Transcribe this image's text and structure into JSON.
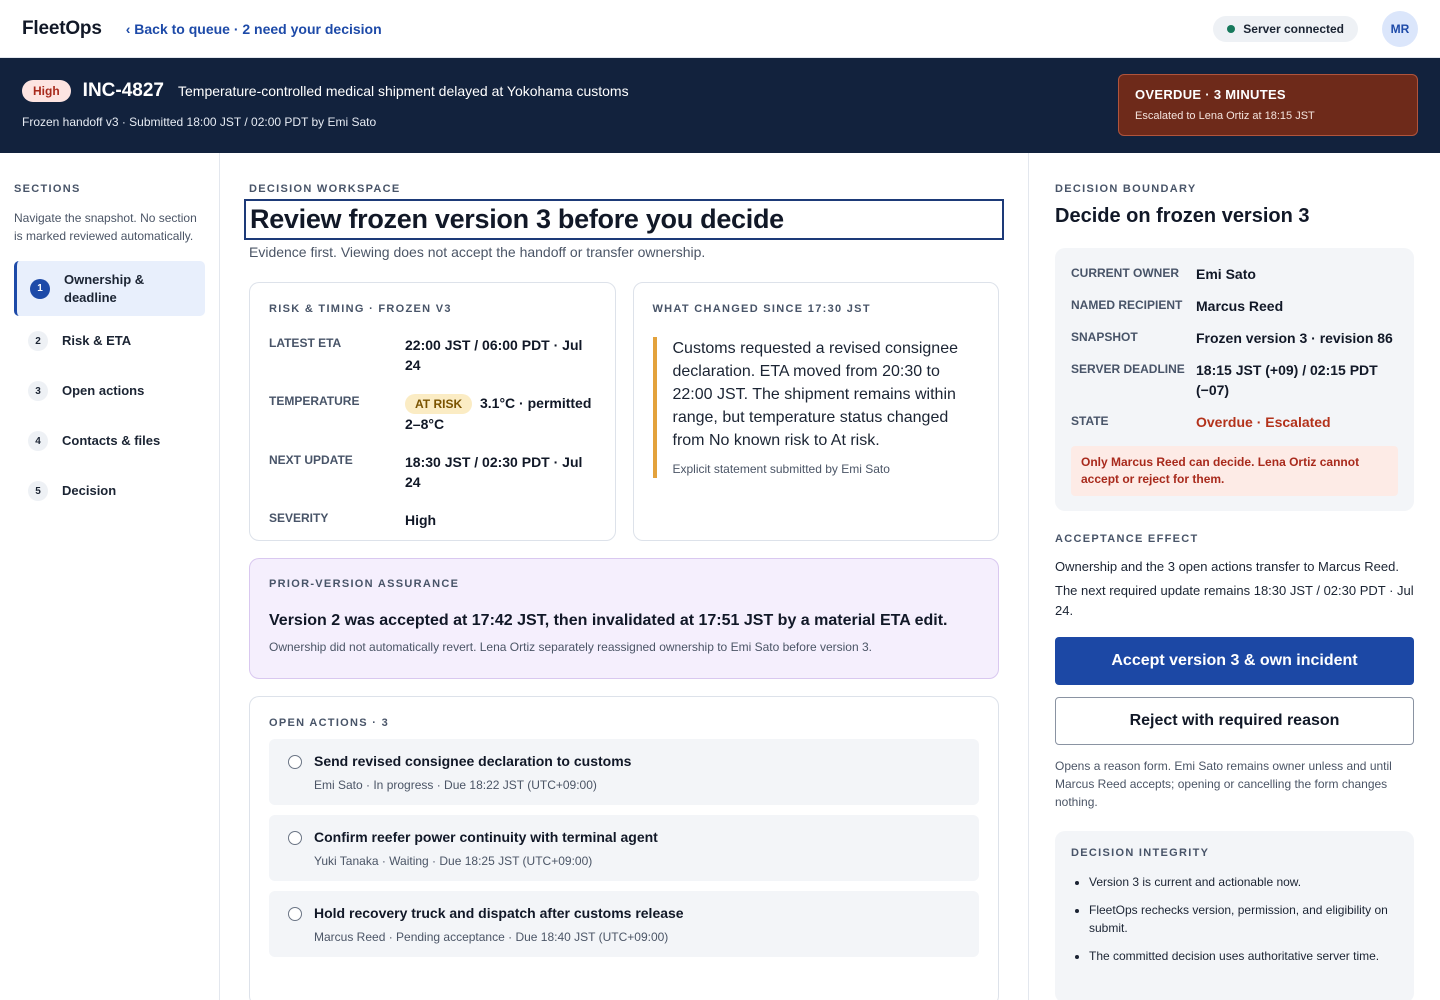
{
  "app": {
    "logo": "FleetOps",
    "back_link": "‹ Back to queue · 2 need your decision"
  },
  "server": {
    "status": "Server connected",
    "status_color": "#17795c"
  },
  "user": {
    "initials": "MR"
  },
  "incident": {
    "severity": "High",
    "id": "INC-4827",
    "title": "Temperature-controlled medical shipment delayed at Yokohama customs",
    "subtitle": "Frozen handoff v3 · Submitted 18:00 JST / 02:00 PDT by Emi Sato",
    "overdue_title": "OVERDUE · 3 MINUTES",
    "overdue_sub": "Escalated to Lena Ortiz at 18:15 JST"
  },
  "sections": {
    "heading": "SECTIONS",
    "description": "Navigate the snapshot. No section is marked reviewed automatically.",
    "items": [
      {
        "num": "1",
        "label": "Ownership & deadline"
      },
      {
        "num": "2",
        "label": "Risk & ETA"
      },
      {
        "num": "3",
        "label": "Open actions"
      },
      {
        "num": "4",
        "label": "Contacts & files"
      },
      {
        "num": "5",
        "label": "Decision"
      }
    ]
  },
  "workspace": {
    "eyebrow": "DECISION WORKSPACE",
    "title": "Review frozen version 3 before you decide",
    "subtitle": "Evidence first. Viewing does not accept the handoff or transfer ownership."
  },
  "risk": {
    "heading": "RISK & TIMING · FROZEN V3",
    "latest_eta_label": "LATEST ETA",
    "latest_eta": "22:00 JST / 06:00 PDT · Jul 24",
    "temperature_label": "TEMPERATURE",
    "temperature_badge": "AT RISK",
    "temperature_value": "3.1°C · permitted 2–8°C",
    "next_update_label": "NEXT UPDATE",
    "next_update": "18:30 JST / 02:30 PDT · Jul 24",
    "severity_label": "SEVERITY",
    "severity": "High"
  },
  "changed": {
    "heading": "WHAT CHANGED SINCE 17:30 JST",
    "text": "Customs requested a revised consignee declaration. ETA moved from 20:30 to 22:00 JST. The shipment remains within range, but temperature status changed from No known risk to At risk.",
    "attribution": "Explicit statement submitted by Emi Sato"
  },
  "prior": {
    "heading": "PRIOR-VERSION ASSURANCE",
    "title": "Version 2 was accepted at 17:42 JST, then invalidated at 17:51 JST by a material ETA edit.",
    "note": "Ownership did not automatically revert. Lena Ortiz separately reassigned ownership to Emi Sato before version 3."
  },
  "open_actions": {
    "heading": "OPEN ACTIONS · 3",
    "items": [
      {
        "title": "Send revised consignee declaration to customs",
        "meta": "Emi Sato · In progress · Due 18:22 JST (UTC+09:00)"
      },
      {
        "title": "Confirm reefer power continuity with terminal agent",
        "meta": "Yuki Tanaka · Waiting · Due 18:25 JST (UTC+09:00)"
      },
      {
        "title": "Hold recovery truck and dispatch after customs release",
        "meta": "Marcus Reed · Pending acceptance · Due 18:40 JST (UTC+09:00)"
      }
    ]
  },
  "boundary": {
    "eyebrow": "DECISION BOUNDARY",
    "title": "Decide on frozen version 3",
    "current_owner_label": "CURRENT OWNER",
    "current_owner": "Emi Sato",
    "recipient_label": "NAMED RECIPIENT",
    "recipient": "Marcus Reed",
    "snapshot_label": "SNAPSHOT",
    "snapshot": "Frozen version 3 · revision 86",
    "deadline_label": "SERVER DEADLINE",
    "deadline": "18:15 JST (+09) / 02:15 PDT (−07)",
    "state_label": "STATE",
    "state": "Overdue · Escalated",
    "warning": "Only Marcus Reed can decide. Lena Ortiz cannot accept or reject for them."
  },
  "effect": {
    "eyebrow": "ACCEPTANCE EFFECT",
    "line1": "Ownership and the 3 open actions transfer to Marcus Reed.",
    "line2": "The next required update remains 18:30 JST / 02:30 PDT · Jul 24.",
    "accept_label": "Accept version 3 & own incident",
    "reject_label": "Reject with required reason",
    "reject_note": "Opens a reason form. Emi Sato remains owner unless and until Marcus Reed accepts; opening or cancelling the form changes nothing."
  },
  "integrity": {
    "heading": "DECISION INTEGRITY",
    "items": [
      "Version 3 is current and actionable now.",
      "FleetOps rechecks version, permission, and eligibility on submit.",
      "The committed decision uses authoritative server time."
    ]
  }
}
